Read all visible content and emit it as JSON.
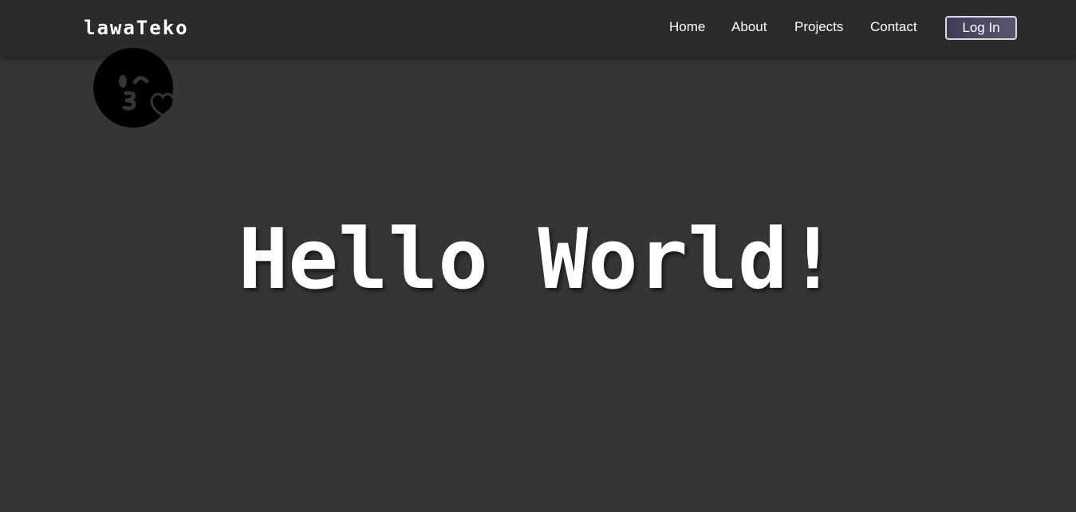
{
  "navbar": {
    "brand": "lawaTeko",
    "links": [
      {
        "label": "Home"
      },
      {
        "label": "About"
      },
      {
        "label": "Projects"
      },
      {
        "label": "Contact"
      }
    ],
    "login_label": "Log In"
  },
  "avatar": {
    "icon": "face-blowing-kiss-icon"
  },
  "hero": {
    "title": "Hello World!"
  },
  "colors": {
    "background": "#353535",
    "navbar": "#2b2b2b",
    "text": "#ffffff",
    "button_border": "#d8d8e0",
    "button_fill": "#4a4560"
  }
}
